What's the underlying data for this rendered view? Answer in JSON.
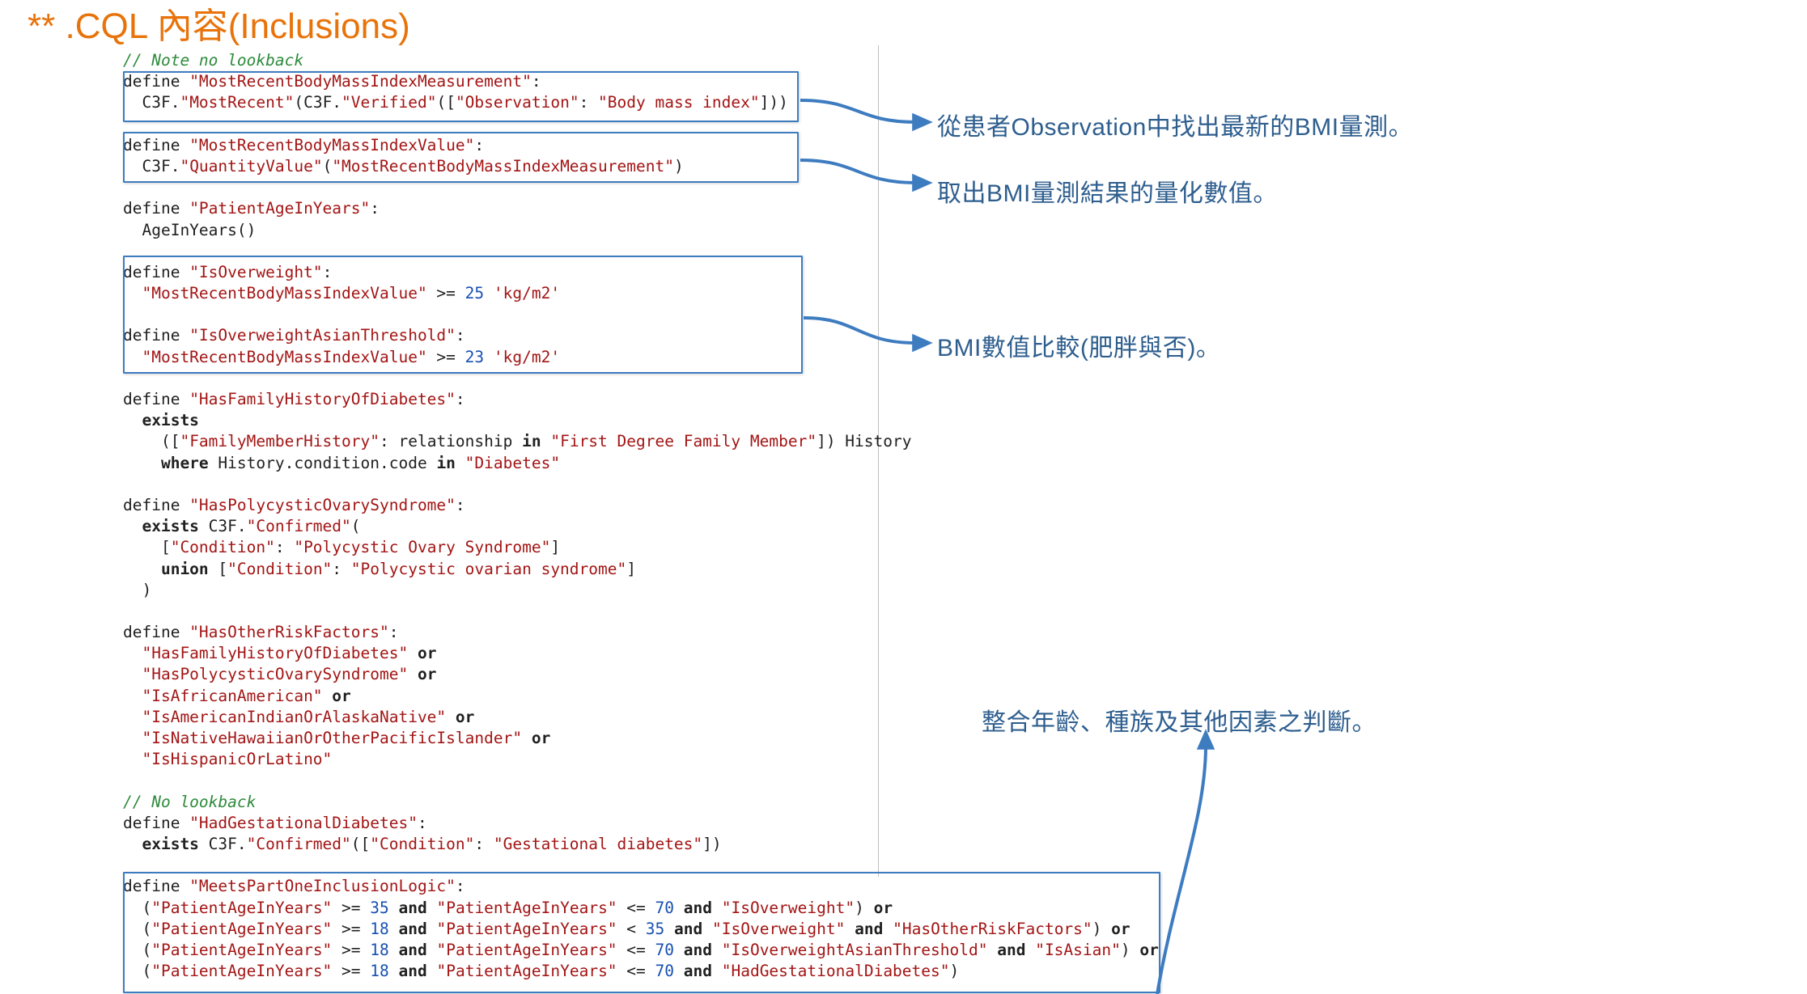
{
  "slide": {
    "title": "** .CQL 內容(Inclusions)",
    "title_color": "#E8730A"
  },
  "code": {
    "language": "CQL",
    "lines": [
      [
        {
          "t": "cmt",
          "s": "// Note no lookback"
        }
      ],
      [
        {
          "t": "kw",
          "s": "define "
        },
        {
          "t": "str",
          "s": "\"MostRecentBodyMassIndexMeasurement\""
        },
        {
          "t": "op",
          "s": ":"
        }
      ],
      [
        {
          "t": "pl",
          "s": "  C3F."
        },
        {
          "t": "str",
          "s": "\"MostRecent\""
        },
        {
          "t": "op",
          "s": "(C3F."
        },
        {
          "t": "str",
          "s": "\"Verified\""
        },
        {
          "t": "op",
          "s": "(["
        },
        {
          "t": "str",
          "s": "\"Observation\""
        },
        {
          "t": "op",
          "s": ": "
        },
        {
          "t": "str",
          "s": "\"Body mass index\""
        },
        {
          "t": "op",
          "s": "]))"
        }
      ],
      [],
      [
        {
          "t": "kw",
          "s": "define "
        },
        {
          "t": "str",
          "s": "\"MostRecentBodyMassIndexValue\""
        },
        {
          "t": "op",
          "s": ":"
        }
      ],
      [
        {
          "t": "pl",
          "s": "  C3F."
        },
        {
          "t": "str",
          "s": "\"QuantityValue\""
        },
        {
          "t": "op",
          "s": "("
        },
        {
          "t": "str",
          "s": "\"MostRecentBodyMassIndexMeasurement\""
        },
        {
          "t": "op",
          "s": ")"
        }
      ],
      [],
      [
        {
          "t": "kw",
          "s": "define "
        },
        {
          "t": "str",
          "s": "\"PatientAgeInYears\""
        },
        {
          "t": "op",
          "s": ":"
        }
      ],
      [
        {
          "t": "pl",
          "s": "  AgeInYears()"
        }
      ],
      [],
      [
        {
          "t": "kw",
          "s": "define "
        },
        {
          "t": "str",
          "s": "\"IsOverweight\""
        },
        {
          "t": "op",
          "s": ":"
        }
      ],
      [
        {
          "t": "pl",
          "s": "  "
        },
        {
          "t": "str",
          "s": "\"MostRecentBodyMassIndexValue\""
        },
        {
          "t": "op",
          "s": " >= "
        },
        {
          "t": "num",
          "s": "25"
        },
        {
          "t": "op",
          "s": " "
        },
        {
          "t": "str",
          "s": "'kg/m2'"
        }
      ],
      [],
      [
        {
          "t": "kw",
          "s": "define "
        },
        {
          "t": "str",
          "s": "\"IsOverweightAsianThreshold\""
        },
        {
          "t": "op",
          "s": ":"
        }
      ],
      [
        {
          "t": "pl",
          "s": "  "
        },
        {
          "t": "str",
          "s": "\"MostRecentBodyMassIndexValue\""
        },
        {
          "t": "op",
          "s": " >= "
        },
        {
          "t": "num",
          "s": "23"
        },
        {
          "t": "op",
          "s": " "
        },
        {
          "t": "str",
          "s": "'kg/m2'"
        }
      ],
      [],
      [
        {
          "t": "kw",
          "s": "define "
        },
        {
          "t": "str",
          "s": "\"HasFamilyHistoryOfDiabetes\""
        },
        {
          "t": "op",
          "s": ":"
        }
      ],
      [
        {
          "t": "bold",
          "s": "  exists"
        }
      ],
      [
        {
          "t": "op",
          "s": "    (["
        },
        {
          "t": "str",
          "s": "\"FamilyMemberHistory\""
        },
        {
          "t": "op",
          "s": ": relationship "
        },
        {
          "t": "bold",
          "s": "in"
        },
        {
          "t": "op",
          "s": " "
        },
        {
          "t": "str",
          "s": "\"First Degree Family Member\""
        },
        {
          "t": "op",
          "s": "]) History"
        }
      ],
      [
        {
          "t": "bold",
          "s": "    where"
        },
        {
          "t": "op",
          "s": " History.condition.code "
        },
        {
          "t": "bold",
          "s": "in"
        },
        {
          "t": "op",
          "s": " "
        },
        {
          "t": "str",
          "s": "\"Diabetes\""
        }
      ],
      [],
      [
        {
          "t": "kw",
          "s": "define "
        },
        {
          "t": "str",
          "s": "\"HasPolycysticOvarySyndrome\""
        },
        {
          "t": "op",
          "s": ":"
        }
      ],
      [
        {
          "t": "bold",
          "s": "  exists"
        },
        {
          "t": "pl",
          "s": " C3F."
        },
        {
          "t": "str",
          "s": "\"Confirmed\""
        },
        {
          "t": "op",
          "s": "("
        }
      ],
      [
        {
          "t": "op",
          "s": "    ["
        },
        {
          "t": "str",
          "s": "\"Condition\""
        },
        {
          "t": "op",
          "s": ": "
        },
        {
          "t": "str",
          "s": "\"Polycystic Ovary Syndrome\""
        },
        {
          "t": "op",
          "s": "]"
        }
      ],
      [
        {
          "t": "bold",
          "s": "    union"
        },
        {
          "t": "op",
          "s": " ["
        },
        {
          "t": "str",
          "s": "\"Condition\""
        },
        {
          "t": "op",
          "s": ": "
        },
        {
          "t": "str",
          "s": "\"Polycystic ovarian syndrome\""
        },
        {
          "t": "op",
          "s": "]"
        }
      ],
      [
        {
          "t": "op",
          "s": "  )"
        }
      ],
      [],
      [
        {
          "t": "kw",
          "s": "define "
        },
        {
          "t": "str",
          "s": "\"HasOtherRiskFactors\""
        },
        {
          "t": "op",
          "s": ":"
        }
      ],
      [
        {
          "t": "pl",
          "s": "  "
        },
        {
          "t": "str",
          "s": "\"HasFamilyHistoryOfDiabetes\""
        },
        {
          "t": "op",
          "s": " "
        },
        {
          "t": "bold",
          "s": "or"
        }
      ],
      [
        {
          "t": "pl",
          "s": "  "
        },
        {
          "t": "str",
          "s": "\"HasPolycysticOvarySyndrome\""
        },
        {
          "t": "op",
          "s": " "
        },
        {
          "t": "bold",
          "s": "or"
        }
      ],
      [
        {
          "t": "pl",
          "s": "  "
        },
        {
          "t": "str",
          "s": "\"IsAfricanAmerican\""
        },
        {
          "t": "op",
          "s": " "
        },
        {
          "t": "bold",
          "s": "or"
        }
      ],
      [
        {
          "t": "pl",
          "s": "  "
        },
        {
          "t": "str",
          "s": "\"IsAmericanIndianOrAlaskaNative\""
        },
        {
          "t": "op",
          "s": " "
        },
        {
          "t": "bold",
          "s": "or"
        }
      ],
      [
        {
          "t": "pl",
          "s": "  "
        },
        {
          "t": "str",
          "s": "\"IsNativeHawaiianOrOtherPacificIslander\""
        },
        {
          "t": "op",
          "s": " "
        },
        {
          "t": "bold",
          "s": "or"
        }
      ],
      [
        {
          "t": "pl",
          "s": "  "
        },
        {
          "t": "str",
          "s": "\"IsHispanicOrLatino\""
        }
      ],
      [],
      [
        {
          "t": "cmt",
          "s": "// No lookback"
        }
      ],
      [
        {
          "t": "kw",
          "s": "define "
        },
        {
          "t": "str",
          "s": "\"HadGestationalDiabetes\""
        },
        {
          "t": "op",
          "s": ":"
        }
      ],
      [
        {
          "t": "bold",
          "s": "  exists"
        },
        {
          "t": "pl",
          "s": " C3F."
        },
        {
          "t": "str",
          "s": "\"Confirmed\""
        },
        {
          "t": "op",
          "s": "(["
        },
        {
          "t": "str",
          "s": "\"Condition\""
        },
        {
          "t": "op",
          "s": ": "
        },
        {
          "t": "str",
          "s": "\"Gestational diabetes\""
        },
        {
          "t": "op",
          "s": "])"
        }
      ],
      [],
      [
        {
          "t": "kw",
          "s": "define "
        },
        {
          "t": "str",
          "s": "\"MeetsPartOneInclusionLogic\""
        },
        {
          "t": "op",
          "s": ":"
        }
      ],
      [
        {
          "t": "op",
          "s": "  ("
        },
        {
          "t": "str",
          "s": "\"PatientAgeInYears\""
        },
        {
          "t": "op",
          "s": " >= "
        },
        {
          "t": "num",
          "s": "35"
        },
        {
          "t": "op",
          "s": " "
        },
        {
          "t": "bold",
          "s": "and"
        },
        {
          "t": "op",
          "s": " "
        },
        {
          "t": "str",
          "s": "\"PatientAgeInYears\""
        },
        {
          "t": "op",
          "s": " <= "
        },
        {
          "t": "num",
          "s": "70"
        },
        {
          "t": "op",
          "s": " "
        },
        {
          "t": "bold",
          "s": "and"
        },
        {
          "t": "op",
          "s": " "
        },
        {
          "t": "str",
          "s": "\"IsOverweight\""
        },
        {
          "t": "op",
          "s": ") "
        },
        {
          "t": "bold",
          "s": "or"
        }
      ],
      [
        {
          "t": "op",
          "s": "  ("
        },
        {
          "t": "str",
          "s": "\"PatientAgeInYears\""
        },
        {
          "t": "op",
          "s": " >= "
        },
        {
          "t": "num",
          "s": "18"
        },
        {
          "t": "op",
          "s": " "
        },
        {
          "t": "bold",
          "s": "and"
        },
        {
          "t": "op",
          "s": " "
        },
        {
          "t": "str",
          "s": "\"PatientAgeInYears\""
        },
        {
          "t": "op",
          "s": " < "
        },
        {
          "t": "num",
          "s": "35"
        },
        {
          "t": "op",
          "s": " "
        },
        {
          "t": "bold",
          "s": "and"
        },
        {
          "t": "op",
          "s": " "
        },
        {
          "t": "str",
          "s": "\"IsOverweight\""
        },
        {
          "t": "op",
          "s": " "
        },
        {
          "t": "bold",
          "s": "and"
        },
        {
          "t": "op",
          "s": " "
        },
        {
          "t": "str",
          "s": "\"HasOtherRiskFactors\""
        },
        {
          "t": "op",
          "s": ") "
        },
        {
          "t": "bold",
          "s": "or"
        }
      ],
      [
        {
          "t": "op",
          "s": "  ("
        },
        {
          "t": "str",
          "s": "\"PatientAgeInYears\""
        },
        {
          "t": "op",
          "s": " >= "
        },
        {
          "t": "num",
          "s": "18"
        },
        {
          "t": "op",
          "s": " "
        },
        {
          "t": "bold",
          "s": "and"
        },
        {
          "t": "op",
          "s": " "
        },
        {
          "t": "str",
          "s": "\"PatientAgeInYears\""
        },
        {
          "t": "op",
          "s": " <= "
        },
        {
          "t": "num",
          "s": "70"
        },
        {
          "t": "op",
          "s": " "
        },
        {
          "t": "bold",
          "s": "and"
        },
        {
          "t": "op",
          "s": " "
        },
        {
          "t": "str",
          "s": "\"IsOverweightAsianThreshold\""
        },
        {
          "t": "op",
          "s": " "
        },
        {
          "t": "bold",
          "s": "and"
        },
        {
          "t": "op",
          "s": " "
        },
        {
          "t": "str",
          "s": "\"IsAsian\""
        },
        {
          "t": "op",
          "s": ") "
        },
        {
          "t": "bold",
          "s": "or"
        }
      ],
      [
        {
          "t": "op",
          "s": "  ("
        },
        {
          "t": "str",
          "s": "\"PatientAgeInYears\""
        },
        {
          "t": "op",
          "s": " >= "
        },
        {
          "t": "num",
          "s": "18"
        },
        {
          "t": "op",
          "s": " "
        },
        {
          "t": "bold",
          "s": "and"
        },
        {
          "t": "op",
          "s": " "
        },
        {
          "t": "str",
          "s": "\"PatientAgeInYears\""
        },
        {
          "t": "op",
          "s": " <= "
        },
        {
          "t": "num",
          "s": "70"
        },
        {
          "t": "op",
          "s": " "
        },
        {
          "t": "bold",
          "s": "and"
        },
        {
          "t": "op",
          "s": " "
        },
        {
          "t": "str",
          "s": "\"HadGestationalDiabetes\""
        },
        {
          "t": "op",
          "s": ")"
        }
      ]
    ]
  },
  "highlight_boxes": [
    {
      "name": "most-recent-bmi-measurement",
      "label": "MostRecentBodyMassIndexMeasurement"
    },
    {
      "name": "most-recent-bmi-value",
      "label": "MostRecentBodyMassIndexValue"
    },
    {
      "name": "overweight-thresholds",
      "label": "IsOverweight / IsOverweightAsianThreshold"
    },
    {
      "name": "meets-part-one-inclusion-logic",
      "label": "MeetsPartOneInclusionLogic"
    }
  ],
  "annotations": [
    {
      "id": "annot-1",
      "text": "從患者Observation中找出最新的BMI量測。"
    },
    {
      "id": "annot-2",
      "text": "取出BMI量測結果的量化數值。"
    },
    {
      "id": "annot-3",
      "text": "BMI數值比較(肥胖與否)。"
    },
    {
      "id": "annot-4",
      "text": "整合年齡、種族及其他因素之判斷。"
    }
  ],
  "colors": {
    "title": "#E8730A",
    "annotation": "#2E5E8E",
    "arrow": "#3E7CC0",
    "box_border": "#3E7CC0",
    "comment": "#2E8B3C",
    "string": "#A31515",
    "number": "#1750B0",
    "guide_line": "#BFBFBF"
  }
}
